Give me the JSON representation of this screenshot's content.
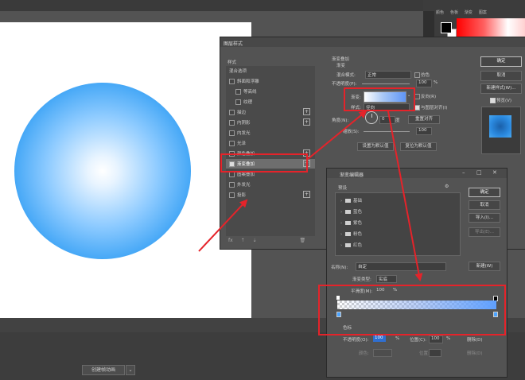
{
  "workspace": {
    "timeline_button": "创建帧动画",
    "timeline_arrow": "⌄"
  },
  "right_panel": {
    "tabs": [
      "颜色",
      "色板",
      "渐变",
      "图案"
    ]
  },
  "layer_style": {
    "title": "图层样式",
    "left_header": "样式",
    "blend_options": "混合选项",
    "items": [
      {
        "label": "斜面和浮雕",
        "checked": false,
        "indent": false
      },
      {
        "label": "等高线",
        "checked": false,
        "indent": true
      },
      {
        "label": "纹理",
        "checked": false,
        "indent": true
      },
      {
        "label": "描边",
        "checked": false,
        "indent": false,
        "plus": true
      },
      {
        "label": "内阴影",
        "checked": false,
        "indent": false,
        "plus": true
      },
      {
        "label": "内发光",
        "checked": false,
        "indent": false
      },
      {
        "label": "光泽",
        "checked": false,
        "indent": false
      },
      {
        "label": "颜色叠加",
        "checked": false,
        "indent": false,
        "plus": true
      },
      {
        "label": "渐变叠加",
        "checked": true,
        "indent": false,
        "plus": true,
        "selected": true
      },
      {
        "label": "图案叠加",
        "checked": false,
        "indent": false
      },
      {
        "label": "外发光",
        "checked": false,
        "indent": false
      },
      {
        "label": "投影",
        "checked": false,
        "indent": false,
        "plus": true
      }
    ],
    "footer_icons": [
      "fx",
      "⇡",
      "⇣",
      "🗑"
    ],
    "section_title": "渐变叠加",
    "section_sub": "渐变",
    "blend_mode_label": "混合模式:",
    "blend_mode_value": "正常",
    "dither_label": "仿色",
    "opacity_label": "不透明度(P):",
    "opacity_value": "100",
    "opacity_unit": "%",
    "gradient_label": "渐变:",
    "reverse_label": "反向(R)",
    "style_label": "样式:",
    "style_value": "径向",
    "align_label": "与图层对齐(I)",
    "angle_label": "角度(N):",
    "angle_value": "0",
    "angle_unit": "度",
    "reset_align": "重置对齐",
    "scale_label": "缩放(S):",
    "scale_value": "100",
    "default_btn": "设置为默认值",
    "reset_default_btn": "复位为默认值",
    "ok": "确定",
    "cancel": "取消",
    "new_style": "新建样式(W)...",
    "preview_label": "预览(V)"
  },
  "gradient_editor": {
    "title": "渐变编辑器",
    "presets_label": "预设",
    "gear": "⚙",
    "presets": [
      "基础",
      "蓝色",
      "紫色",
      "粉色",
      "红色"
    ],
    "ok": "确定",
    "cancel": "取消",
    "import": "导入(I)...",
    "export": "导出(E)...",
    "name_label": "名称(N):",
    "name_value": "自定",
    "new_btn": "新建(W)",
    "type_label": "渐变类型:",
    "type_value": "实底",
    "smooth_label": "平滑度(M):",
    "smooth_value": "100",
    "smooth_unit": "%",
    "stops_label": "色标",
    "opacity_label": "不透明度(O):",
    "opacity_value": "100",
    "location_label": "位置(C):",
    "location_value": "100",
    "delete_label": "删除(D)",
    "color_label": "颜色:",
    "color_loc_label": "位置:",
    "color_delete": "删除(D)",
    "pct": "%"
  },
  "colors": {
    "annotation_red": "#e5232a",
    "gradient_end": "#5fa0ff",
    "sphere_edge": "#1d8fef"
  }
}
